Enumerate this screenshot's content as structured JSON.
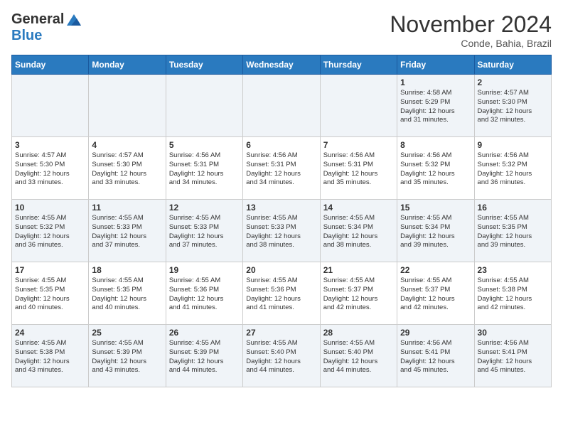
{
  "header": {
    "logo_general": "General",
    "logo_blue": "Blue",
    "month_title": "November 2024",
    "subtitle": "Conde, Bahia, Brazil"
  },
  "days_of_week": [
    "Sunday",
    "Monday",
    "Tuesday",
    "Wednesday",
    "Thursday",
    "Friday",
    "Saturday"
  ],
  "weeks": [
    [
      {
        "day": "",
        "info": ""
      },
      {
        "day": "",
        "info": ""
      },
      {
        "day": "",
        "info": ""
      },
      {
        "day": "",
        "info": ""
      },
      {
        "day": "",
        "info": ""
      },
      {
        "day": "1",
        "info": "Sunrise: 4:58 AM\nSunset: 5:29 PM\nDaylight: 12 hours\nand 31 minutes."
      },
      {
        "day": "2",
        "info": "Sunrise: 4:57 AM\nSunset: 5:30 PM\nDaylight: 12 hours\nand 32 minutes."
      }
    ],
    [
      {
        "day": "3",
        "info": "Sunrise: 4:57 AM\nSunset: 5:30 PM\nDaylight: 12 hours\nand 33 minutes."
      },
      {
        "day": "4",
        "info": "Sunrise: 4:57 AM\nSunset: 5:30 PM\nDaylight: 12 hours\nand 33 minutes."
      },
      {
        "day": "5",
        "info": "Sunrise: 4:56 AM\nSunset: 5:31 PM\nDaylight: 12 hours\nand 34 minutes."
      },
      {
        "day": "6",
        "info": "Sunrise: 4:56 AM\nSunset: 5:31 PM\nDaylight: 12 hours\nand 34 minutes."
      },
      {
        "day": "7",
        "info": "Sunrise: 4:56 AM\nSunset: 5:31 PM\nDaylight: 12 hours\nand 35 minutes."
      },
      {
        "day": "8",
        "info": "Sunrise: 4:56 AM\nSunset: 5:32 PM\nDaylight: 12 hours\nand 35 minutes."
      },
      {
        "day": "9",
        "info": "Sunrise: 4:56 AM\nSunset: 5:32 PM\nDaylight: 12 hours\nand 36 minutes."
      }
    ],
    [
      {
        "day": "10",
        "info": "Sunrise: 4:55 AM\nSunset: 5:32 PM\nDaylight: 12 hours\nand 36 minutes."
      },
      {
        "day": "11",
        "info": "Sunrise: 4:55 AM\nSunset: 5:33 PM\nDaylight: 12 hours\nand 37 minutes."
      },
      {
        "day": "12",
        "info": "Sunrise: 4:55 AM\nSunset: 5:33 PM\nDaylight: 12 hours\nand 37 minutes."
      },
      {
        "day": "13",
        "info": "Sunrise: 4:55 AM\nSunset: 5:33 PM\nDaylight: 12 hours\nand 38 minutes."
      },
      {
        "day": "14",
        "info": "Sunrise: 4:55 AM\nSunset: 5:34 PM\nDaylight: 12 hours\nand 38 minutes."
      },
      {
        "day": "15",
        "info": "Sunrise: 4:55 AM\nSunset: 5:34 PM\nDaylight: 12 hours\nand 39 minutes."
      },
      {
        "day": "16",
        "info": "Sunrise: 4:55 AM\nSunset: 5:35 PM\nDaylight: 12 hours\nand 39 minutes."
      }
    ],
    [
      {
        "day": "17",
        "info": "Sunrise: 4:55 AM\nSunset: 5:35 PM\nDaylight: 12 hours\nand 40 minutes."
      },
      {
        "day": "18",
        "info": "Sunrise: 4:55 AM\nSunset: 5:35 PM\nDaylight: 12 hours\nand 40 minutes."
      },
      {
        "day": "19",
        "info": "Sunrise: 4:55 AM\nSunset: 5:36 PM\nDaylight: 12 hours\nand 41 minutes."
      },
      {
        "day": "20",
        "info": "Sunrise: 4:55 AM\nSunset: 5:36 PM\nDaylight: 12 hours\nand 41 minutes."
      },
      {
        "day": "21",
        "info": "Sunrise: 4:55 AM\nSunset: 5:37 PM\nDaylight: 12 hours\nand 42 minutes."
      },
      {
        "day": "22",
        "info": "Sunrise: 4:55 AM\nSunset: 5:37 PM\nDaylight: 12 hours\nand 42 minutes."
      },
      {
        "day": "23",
        "info": "Sunrise: 4:55 AM\nSunset: 5:38 PM\nDaylight: 12 hours\nand 42 minutes."
      }
    ],
    [
      {
        "day": "24",
        "info": "Sunrise: 4:55 AM\nSunset: 5:38 PM\nDaylight: 12 hours\nand 43 minutes."
      },
      {
        "day": "25",
        "info": "Sunrise: 4:55 AM\nSunset: 5:39 PM\nDaylight: 12 hours\nand 43 minutes."
      },
      {
        "day": "26",
        "info": "Sunrise: 4:55 AM\nSunset: 5:39 PM\nDaylight: 12 hours\nand 44 minutes."
      },
      {
        "day": "27",
        "info": "Sunrise: 4:55 AM\nSunset: 5:40 PM\nDaylight: 12 hours\nand 44 minutes."
      },
      {
        "day": "28",
        "info": "Sunrise: 4:55 AM\nSunset: 5:40 PM\nDaylight: 12 hours\nand 44 minutes."
      },
      {
        "day": "29",
        "info": "Sunrise: 4:56 AM\nSunset: 5:41 PM\nDaylight: 12 hours\nand 45 minutes."
      },
      {
        "day": "30",
        "info": "Sunrise: 4:56 AM\nSunset: 5:41 PM\nDaylight: 12 hours\nand 45 minutes."
      }
    ]
  ]
}
